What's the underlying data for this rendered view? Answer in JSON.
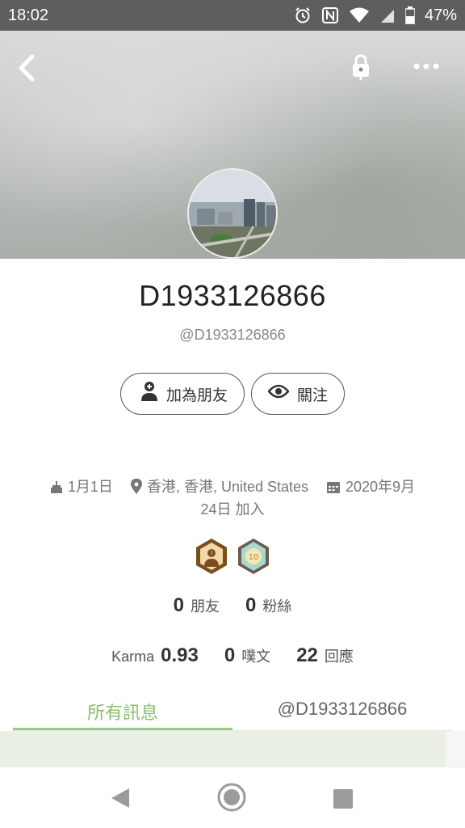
{
  "status_bar": {
    "time": "18:02",
    "battery": "47%",
    "icons": [
      "alarm-icon",
      "nfc-icon",
      "wifi-icon",
      "signal-icon",
      "battery-icon"
    ]
  },
  "cover": {
    "icons": [
      "back-arrow-icon",
      "lock-icon",
      "more-options-icon"
    ]
  },
  "profile": {
    "display_name": "D1933126866",
    "handle": "@D1933126866"
  },
  "actions": {
    "add_friend": "加為朋友",
    "follow": "關注"
  },
  "meta": {
    "birthday": "1月1日",
    "location": "香港, 香港, United States",
    "joined_line1": "2020年9月",
    "joined_line2": "24日 加入"
  },
  "badges": {
    "badge1_icon": "profile-badge-icon",
    "badge2_text": "10"
  },
  "stats": {
    "friends_count": "0",
    "friends_label": "朋友",
    "followers_count": "0",
    "followers_label": "粉絲",
    "karma_label": "Karma",
    "karma_value": "0.93",
    "posts_count": "0",
    "posts_label": "噗文",
    "replies_count": "22",
    "replies_label": "回應"
  },
  "tabs": [
    {
      "label": "所有訊息",
      "active": true
    },
    {
      "label": "@D1933126866",
      "active": false
    }
  ],
  "colors": {
    "accent": "#8bbd70",
    "badge_brown": "#7a4e1c",
    "status_bar": "#5e5e5e"
  },
  "nav_bar": {
    "icons": [
      "nav-back-icon",
      "nav-home-icon",
      "nav-recent-apps-icon"
    ]
  }
}
